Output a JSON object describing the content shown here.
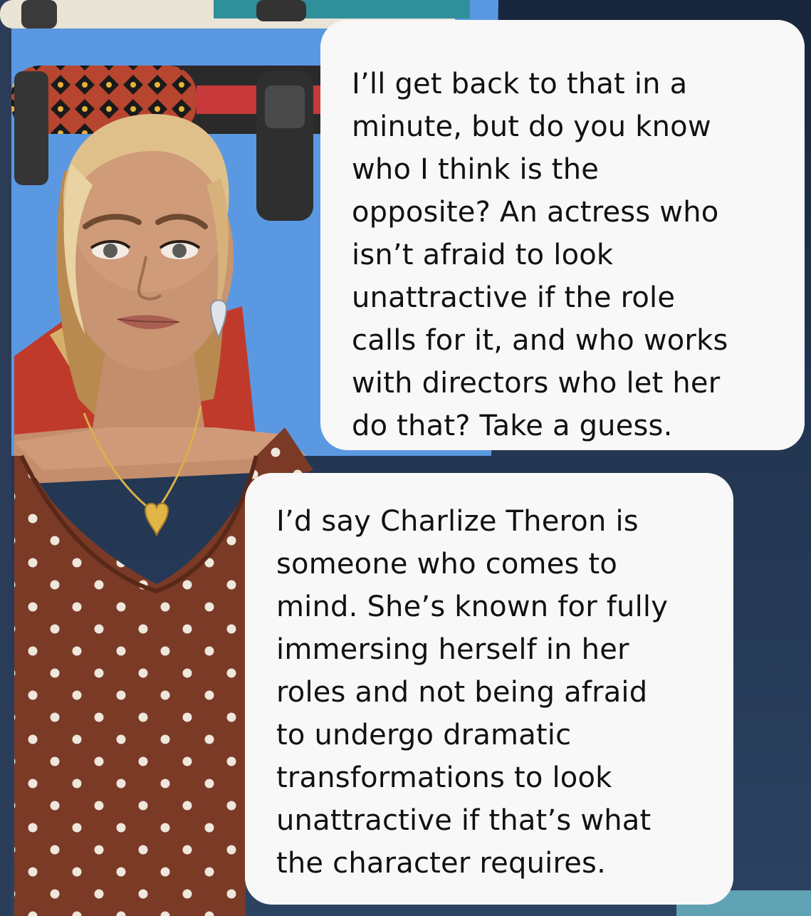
{
  "conversation": {
    "messages": [
      {
        "role": "character",
        "text": "I’ll get back to that in a\nminute, but do you know\nwho I think is the\nopposite? An actress who\nisn’t afraid to look\nunattractive if the role\ncalls for it, and who works\nwith directors who let her\ndo that? Take a guess."
      },
      {
        "role": "user",
        "text": "I’d say Charlize Theron is\nsomeone who comes to\nmind. She’s known for fully\nimmersing herself in her\nroles and not being afraid\nto undergo dramatic\ntransformations to look\nunattractive if that’s what\nthe character requires."
      }
    ]
  },
  "colors": {
    "bubble_background": "#f8f8f9",
    "text": "#111111",
    "wall_blue": "#5b98e2",
    "night_background": "#1f2f45",
    "dress": "#7a3a26",
    "skin": "#c99472",
    "hair": "#e0c08a"
  },
  "icons": [
    "avatar"
  ]
}
